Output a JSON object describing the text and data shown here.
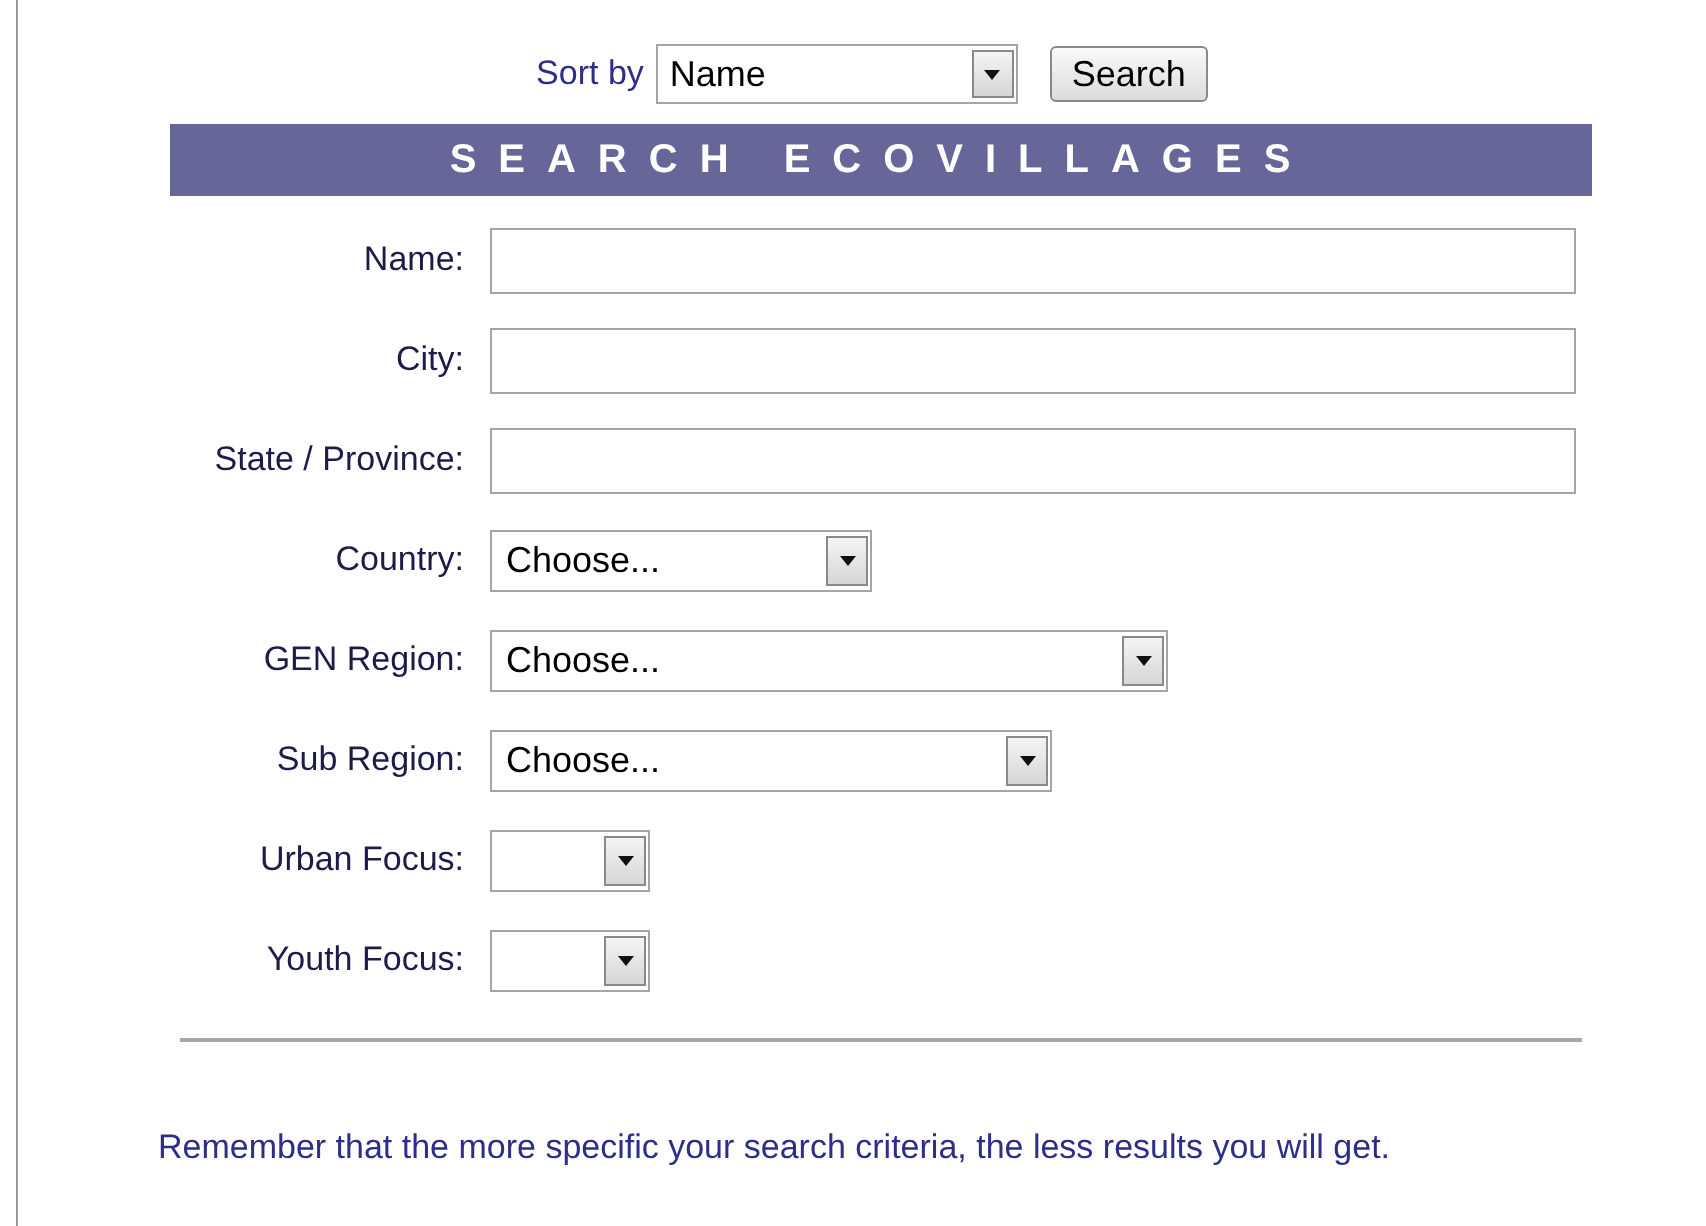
{
  "sort": {
    "label": "Sort by",
    "value": "Name"
  },
  "search_button": "Search",
  "banner": "SEARCH ECOVILLAGES",
  "fields": [
    {
      "kind": "text",
      "label": "Name:"
    },
    {
      "kind": "text",
      "label": "City:"
    },
    {
      "kind": "text",
      "label": "State / Province:"
    },
    {
      "kind": "select",
      "label": "Country:",
      "value": "Choose..."
    },
    {
      "kind": "select",
      "label": "GEN Region:",
      "value": "Choose..."
    },
    {
      "kind": "select",
      "label": "Sub Region:",
      "value": "Choose..."
    },
    {
      "kind": "select",
      "label": "Urban Focus:"
    },
    {
      "kind": "select",
      "label": "Youth Focus:"
    }
  ],
  "note": "Remember that the more specific your search criteria, the less results you will get."
}
